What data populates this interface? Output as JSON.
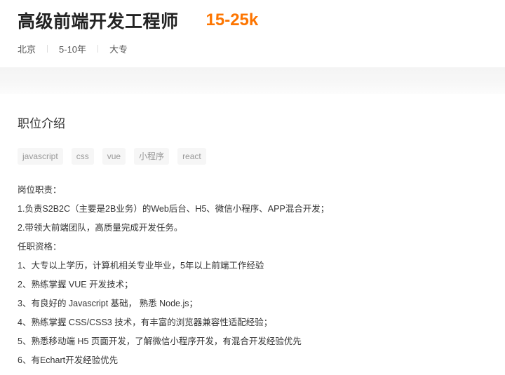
{
  "job": {
    "title": "高级前端开发工程师",
    "salary": "15-25k",
    "meta": [
      "北京",
      "5-10年",
      "大专"
    ]
  },
  "section": {
    "title": "职位介绍",
    "tags": [
      "javascript",
      "css",
      "vue",
      "小程序",
      "react"
    ],
    "lines": [
      "岗位职责：",
      "1.负责S2B2C（主要是2B业务）的Web后台、H5、微信小程序、APP混合开发；",
      "2.带领大前端团队，高质量完成开发任务。",
      "任职资格：",
      "1、大专以上学历，计算机相关专业毕业，5年以上前端工作经验",
      "2、熟练掌握 VUE 开发技术；",
      "3、有良好的 Javascript 基础， 熟悉 Node.js；",
      "4、熟练掌握 CSS/CSS3 技术，有丰富的浏览器兼容性适配经验；",
      "5、熟悉移动端 H5 页面开发，了解微信小程序开发，有混合开发经验优先",
      "6、有Echart开发经验优先"
    ]
  },
  "colors": {
    "salary": "#fd7500",
    "tag_bg": "#f6f6f6",
    "tag_text": "#999999"
  }
}
